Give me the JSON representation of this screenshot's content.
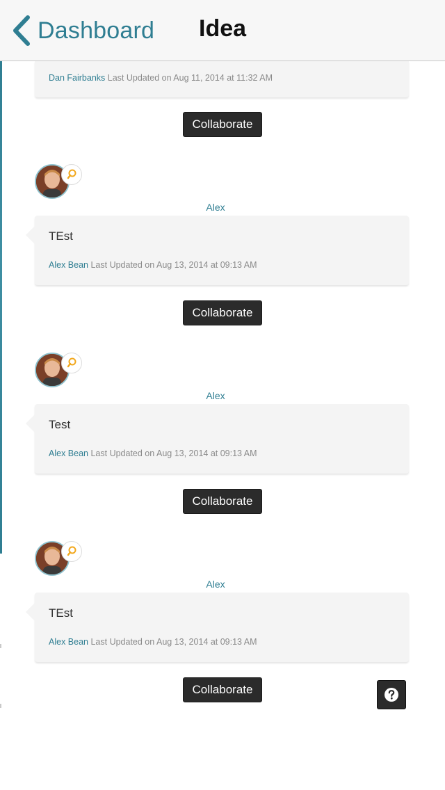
{
  "nav": {
    "back_label": "Dashboard",
    "title": "Idea"
  },
  "first_card": {
    "author": "Dan Fairbanks",
    "updated": "Last Updated on Aug 11, 2014 at 11:32 AM"
  },
  "collaborate_label": "Collaborate",
  "entries": [
    {
      "username": "Alex",
      "text": "TEst",
      "author": "Alex Bean",
      "updated": "Last Updated on Aug 13, 2014 at 09:13 AM"
    },
    {
      "username": "Alex",
      "text": "Test",
      "author": "Alex Bean",
      "updated": "Last Updated on Aug 13, 2014 at 09:13 AM"
    },
    {
      "username": "Alex",
      "text": "TEst",
      "author": "Alex Bean",
      "updated": "Last Updated on Aug 13, 2014 at 09:13 AM"
    }
  ],
  "icons": {
    "back": "chevron-left-icon",
    "idea": "lightbulb-icon",
    "help": "question-circle-icon",
    "avatar": "user-avatar"
  },
  "colors": {
    "accent": "#2f7e92",
    "button_bg": "#2b2b2b",
    "card_bg": "#f4f4f4",
    "idea_badge": "#f2a81d"
  }
}
